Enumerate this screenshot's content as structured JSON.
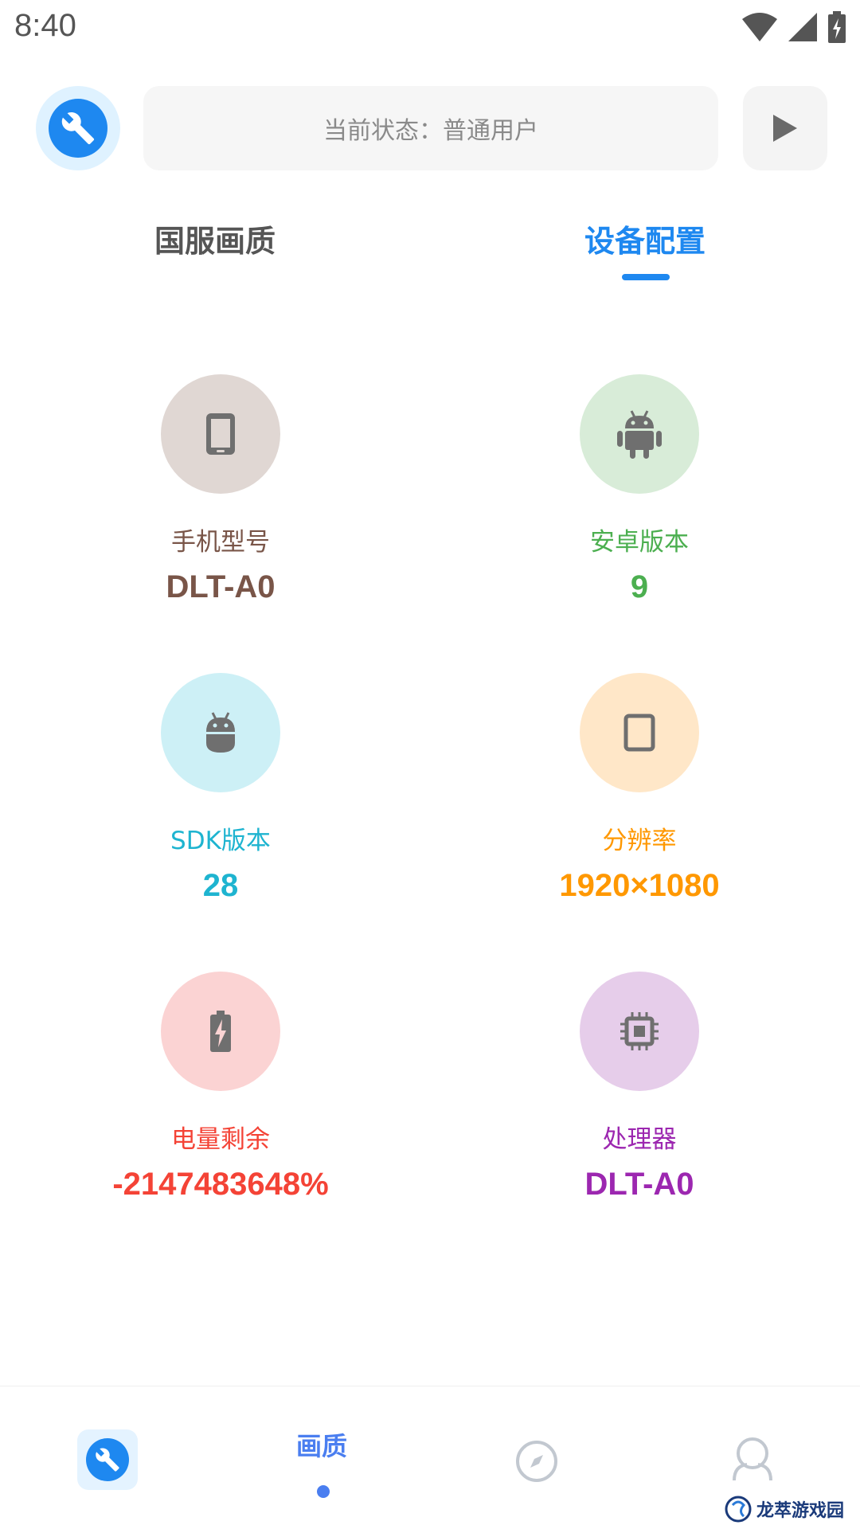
{
  "status_bar": {
    "time": "8:40"
  },
  "top_bar": {
    "status_text": "当前状态：普通用户"
  },
  "tabs": [
    {
      "label": "国服画质",
      "active": false
    },
    {
      "label": "设备配置",
      "active": true
    }
  ],
  "info_items": [
    {
      "label": "手机型号",
      "value": "DLT-A0",
      "color": "#795548",
      "bg": "#e0d7d3",
      "icon": "phone-icon"
    },
    {
      "label": "安卓版本",
      "value": "9",
      "color": "#4caf50",
      "bg": "#d8ecd8",
      "icon": "android-icon"
    },
    {
      "label": "SDK版本",
      "value": "28",
      "color": "#1eb4d0",
      "bg": "#cdf0f6",
      "icon": "android-head-icon"
    },
    {
      "label": "分辨率",
      "value": "1920×1080",
      "color": "#ff9800",
      "bg": "#ffe7c8",
      "icon": "tablet-icon"
    },
    {
      "label": "电量剩余",
      "value": "-2147483648%",
      "color": "#f44336",
      "bg": "#fbd3d3",
      "icon": "battery-icon"
    },
    {
      "label": "处理器",
      "value": "DLT-A0",
      "color": "#9c27b0",
      "bg": "#e6cdea",
      "icon": "chip-icon"
    }
  ],
  "bottom_nav": {
    "quality_label": "画质"
  },
  "watermark": {
    "text": "龙萃游戏园"
  },
  "colors": {
    "accent": "#1e88f0",
    "nav_active": "#4a7ef0"
  }
}
